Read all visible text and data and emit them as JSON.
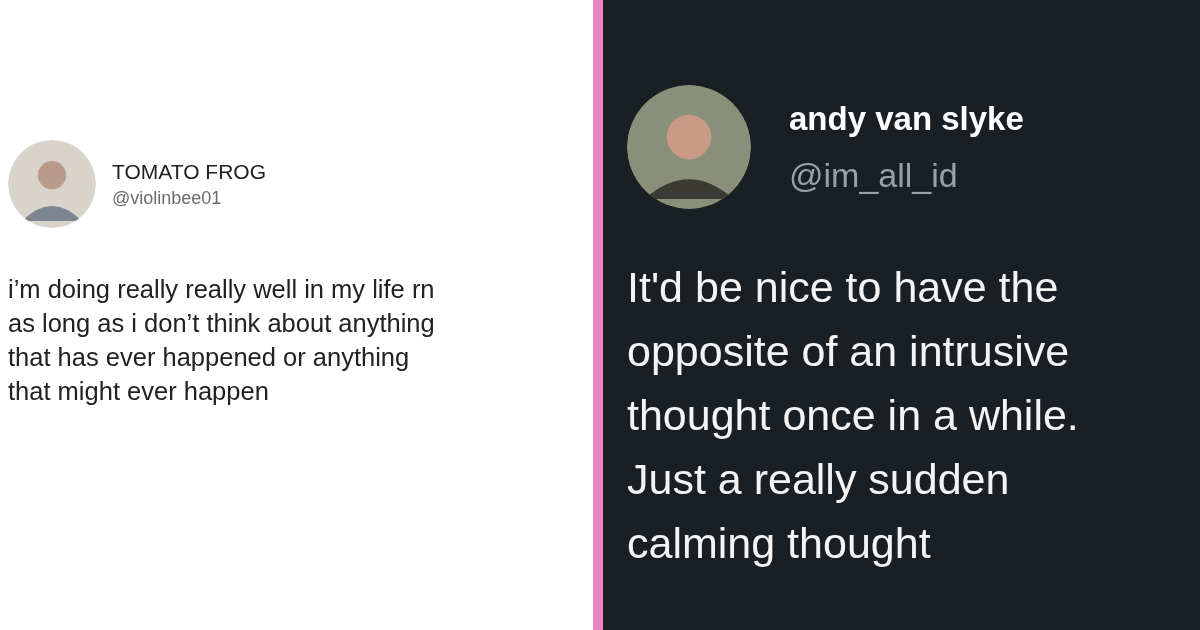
{
  "tweets": [
    {
      "kind": "light",
      "name": "TOMATO FROG",
      "handle": "@violinbee01",
      "lines": [
        "i’m doing really really well in my life rn",
        "as long as i don’t think about anything",
        "that has ever happened or anything",
        "that might ever happen"
      ]
    },
    {
      "kind": "dark",
      "name": "andy van slyke",
      "handle": "@im_all_id",
      "lines": [
        "It'd be nice to have the",
        "opposite of an intrusive",
        "thought once in a while.",
        "Just a really sudden",
        "calming thought"
      ]
    }
  ]
}
